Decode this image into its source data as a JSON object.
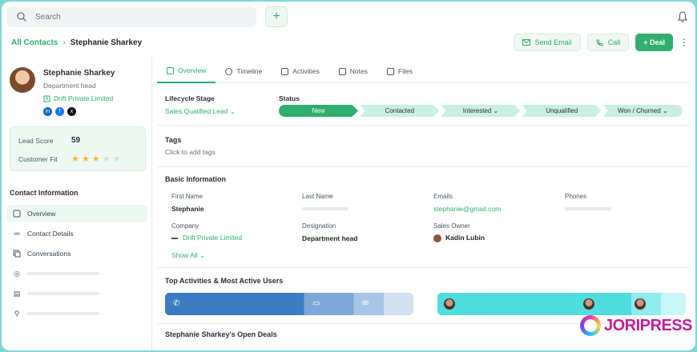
{
  "search": {
    "placeholder": "Search"
  },
  "topbar": {
    "add_label": "+"
  },
  "breadcrumb": {
    "parent": "All Contacts",
    "separator": "›",
    "current": "Stephanie Sharkey"
  },
  "actions": {
    "send_email": "Send Email",
    "call": "Call",
    "deal": "+ Deal",
    "more": "⋮"
  },
  "profile": {
    "name": "Stephanie Sharkey",
    "role": "Department head",
    "company": "Drift Private Limited",
    "socials": [
      "in",
      "f",
      "x"
    ]
  },
  "scores": {
    "lead_score_label": "Lead Score",
    "lead_score": "59",
    "customer_fit_label": "Customer Fit",
    "customer_fit_stars": 3,
    "customer_fit_max": 5
  },
  "sidebar": {
    "title": "Contact Information",
    "items": [
      {
        "label": "Overview",
        "icon": "grid-icon"
      },
      {
        "label": "Contact Details",
        "icon": "list-icon"
      },
      {
        "label": "Conversations",
        "icon": "chat-icon"
      }
    ]
  },
  "tabs": [
    {
      "label": "Overview"
    },
    {
      "label": "Timeline"
    },
    {
      "label": "Activities"
    },
    {
      "label": "Notes"
    },
    {
      "label": "Files"
    }
  ],
  "lifecycle": {
    "label": "Lifecycle Stage",
    "value": "Sales Qualified Lead ⌄"
  },
  "status": {
    "label": "Status",
    "stages": [
      "New",
      "Contacted",
      "Interested ⌄",
      "Unqualified",
      "Won / Churned ⌄"
    ],
    "active_index": 0
  },
  "tags": {
    "title": "Tags",
    "hint": "Click to add tags"
  },
  "basic_info": {
    "title": "Basic Information",
    "first_name_label": "First Name",
    "first_name": "Stephanie",
    "last_name_label": "Last Name",
    "emails_label": "Emails",
    "email": "stephanie@gmail.com",
    "phones_label": "Phones",
    "company_label": "Company",
    "company": "Drift Private Limited",
    "designation_label": "Designation",
    "designation": "Department head",
    "owner_label": "Sales Owner",
    "owner": "Kadin Lubin",
    "show_all": "Show All ⌄"
  },
  "activities": {
    "title": "Top Activities & Most Active Users"
  },
  "deals": {
    "title": "Stephanie Sharkey's Open Deals"
  },
  "watermark": {
    "text": "JORIPRESS"
  },
  "colors": {
    "accent": "#2fae6e",
    "activity_bar": "#3b7cc4",
    "users_bar": "#4fdde0"
  }
}
